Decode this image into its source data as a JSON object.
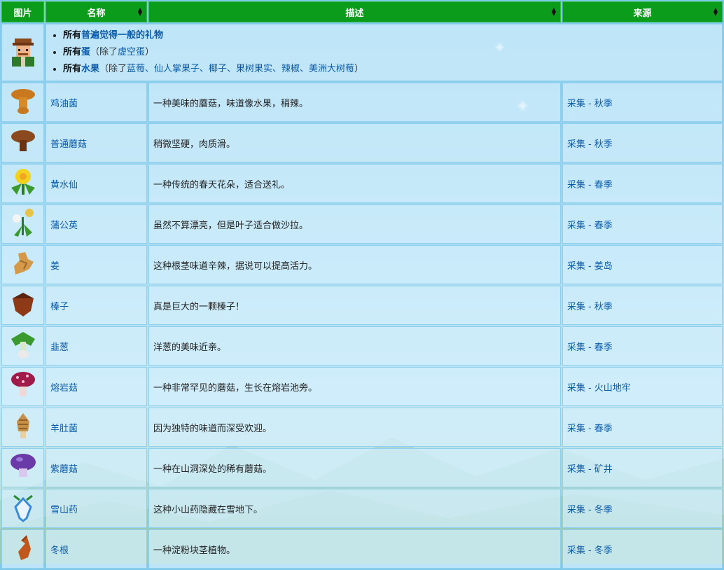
{
  "header": {
    "col_image": "图片",
    "col_name": "名称",
    "col_desc": "描述",
    "col_source": "来源"
  },
  "intro": {
    "line1_prefix": "所有",
    "line1_link": "普遍觉得一般的礼物",
    "line2_prefix": "所有",
    "line2_link": "蛋",
    "line2_paren_open": "（除了",
    "line2_paren_link": "虚空蛋",
    "line2_paren_close": "）",
    "line3_prefix": "所有",
    "line3_link": "水果",
    "line3_paren_open": "（除了",
    "line3_paren_items": "蓝莓、仙人掌果子、椰子、果树果实、辣椒、美洲大树莓",
    "line3_paren_close": "）"
  },
  "rows": [
    {
      "name": "鸡油菌",
      "desc": "一种美味的蘑菇，味道像水果，稍辣。",
      "src_a": "采集",
      "src_b": "秋季",
      "icon": "chanterelle-icon",
      "color": "#c8781e"
    },
    {
      "name": "普通蘑菇",
      "desc": "稍微坚硬，肉质滑。",
      "src_a": "采集",
      "src_b": "秋季",
      "icon": "common-mushroom-icon",
      "color": "#8a4a1e"
    },
    {
      "name": "黄水仙",
      "desc": "一种传统的春天花朵，适合送礼。",
      "src_a": "采集",
      "src_b": "春季",
      "icon": "daffodil-icon",
      "color": "#f2d21e"
    },
    {
      "name": "蒲公英",
      "desc": "虽然不算漂亮，但是叶子适合做沙拉。",
      "src_a": "采集",
      "src_b": "春季",
      "icon": "dandelion-icon",
      "color": "#e8c34a"
    },
    {
      "name": "姜",
      "desc": "这种根茎味道辛辣，据说可以提高活力。",
      "src_a": "采集",
      "src_b": "姜岛",
      "icon": "ginger-icon",
      "color": "#d49a4a"
    },
    {
      "name": "榛子",
      "desc": "真是巨大的一颗榛子！",
      "src_a": "采集",
      "src_b": "秋季",
      "icon": "hazelnut-icon",
      "color": "#8e3a16"
    },
    {
      "name": "韭葱",
      "desc": "洋葱的美味近亲。",
      "src_a": "采集",
      "src_b": "春季",
      "icon": "leek-icon",
      "color": "#3a9a2e"
    },
    {
      "name": "熔岩菇",
      "desc": "一种非常罕见的蘑菇，生长在熔岩池旁。",
      "src_a": "采集",
      "src_b": "火山地牢",
      "icon": "magma-cap-icon",
      "color": "#a01a4a"
    },
    {
      "name": "羊肚菌",
      "desc": "因为独特的味道而深受欢迎。",
      "src_a": "采集",
      "src_b": "春季",
      "icon": "morel-icon",
      "color": "#c89046"
    },
    {
      "name": "紫蘑菇",
      "desc": "一种在山洞深处的稀有蘑菇。",
      "src_a": "采集",
      "src_b": "矿井",
      "icon": "purple-mushroom-icon",
      "color": "#6a3aa8"
    },
    {
      "name": "雪山药",
      "desc": "这种小山药隐藏在雪地下。",
      "src_a": "采集",
      "src_b": "冬季",
      "icon": "snow-yam-icon",
      "color": "#3a8ad8"
    },
    {
      "name": "冬根",
      "desc": "一种淀粉块茎植物。",
      "src_a": "采集",
      "src_b": "冬季",
      "icon": "winter-root-icon",
      "color": "#c0581e"
    }
  ]
}
